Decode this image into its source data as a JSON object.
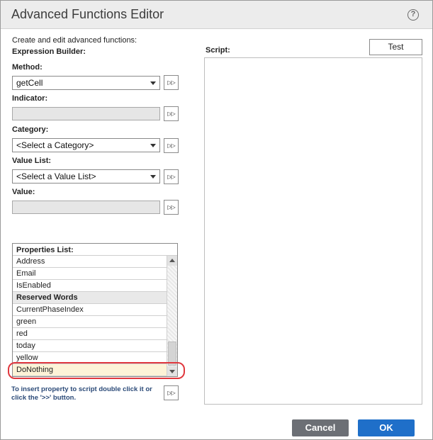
{
  "dialog": {
    "title": "Advanced Functions Editor",
    "help_icon": "?"
  },
  "intro": {
    "description": "Create and edit advanced functions:",
    "builder_heading": "Expression Builder:"
  },
  "fields": {
    "method_label": "Method:",
    "method_value": "getCell",
    "indicator_label": "Indicator:",
    "category_label": "Category:",
    "category_value": "<Select a Category>",
    "value_list_label": "Value List:",
    "value_list_value": "<Select a Value List>",
    "value_label": "Value:"
  },
  "insert_button_glyph": "▷▷",
  "script": {
    "label": "Script:",
    "test_label": "Test"
  },
  "properties": {
    "header": "Properties List:",
    "rows": [
      {
        "label": "Address",
        "type": "item"
      },
      {
        "label": "Email",
        "type": "item"
      },
      {
        "label": "IsEnabled",
        "type": "item"
      },
      {
        "label": "Reserved Words",
        "type": "section"
      },
      {
        "label": "CurrentPhaseIndex",
        "type": "item"
      },
      {
        "label": "green",
        "type": "item"
      },
      {
        "label": "red",
        "type": "item"
      },
      {
        "label": "today",
        "type": "item"
      },
      {
        "label": "yellow",
        "type": "item"
      },
      {
        "label": "DoNothing",
        "type": "selected"
      }
    ]
  },
  "hint": "To insert property to script double click it or click the '>>' button.",
  "footer": {
    "cancel_label": "Cancel",
    "ok_label": "OK"
  },
  "colors": {
    "ok_button": "#1f6fc9",
    "cancel_button": "#6c6f75",
    "highlight_ring": "#e0383e",
    "hint_text": "#2b4a78"
  },
  "icons": {
    "help": "help-circle-icon",
    "insert": "double-arrow-right-icon",
    "dropdown": "chevron-down-icon"
  }
}
